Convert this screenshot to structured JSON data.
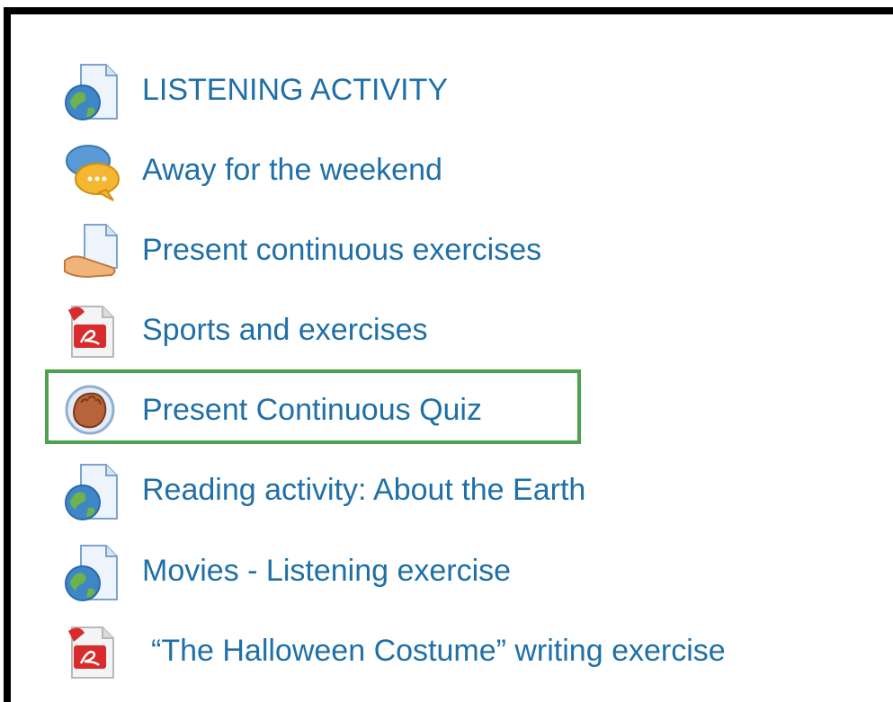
{
  "activities": [
    {
      "label": "LISTENING ACTIVITY",
      "icon": "web-page-icon"
    },
    {
      "label": "Away for the weekend",
      "icon": "chat-bubbles-icon"
    },
    {
      "label": "Present continuous exercises",
      "icon": "assignment-hand-icon"
    },
    {
      "label": "Sports and exercises",
      "icon": "pdf-file-icon"
    },
    {
      "label": "Present Continuous Quiz",
      "icon": "quiz-hand-icon"
    },
    {
      "label": "Reading activity: About the Earth",
      "icon": "web-page-icon"
    },
    {
      "label": "Movies - Listening exercise",
      "icon": "web-page-icon"
    },
    {
      "label": "“The Halloween Costume” writing exercise",
      "icon": "pdf-file-icon"
    }
  ],
  "highlighted_item": "Present Continuous Quiz",
  "colors": {
    "link": "#1f6fa8",
    "highlight_border": "#4fa14f",
    "frame_border": "#000000"
  }
}
